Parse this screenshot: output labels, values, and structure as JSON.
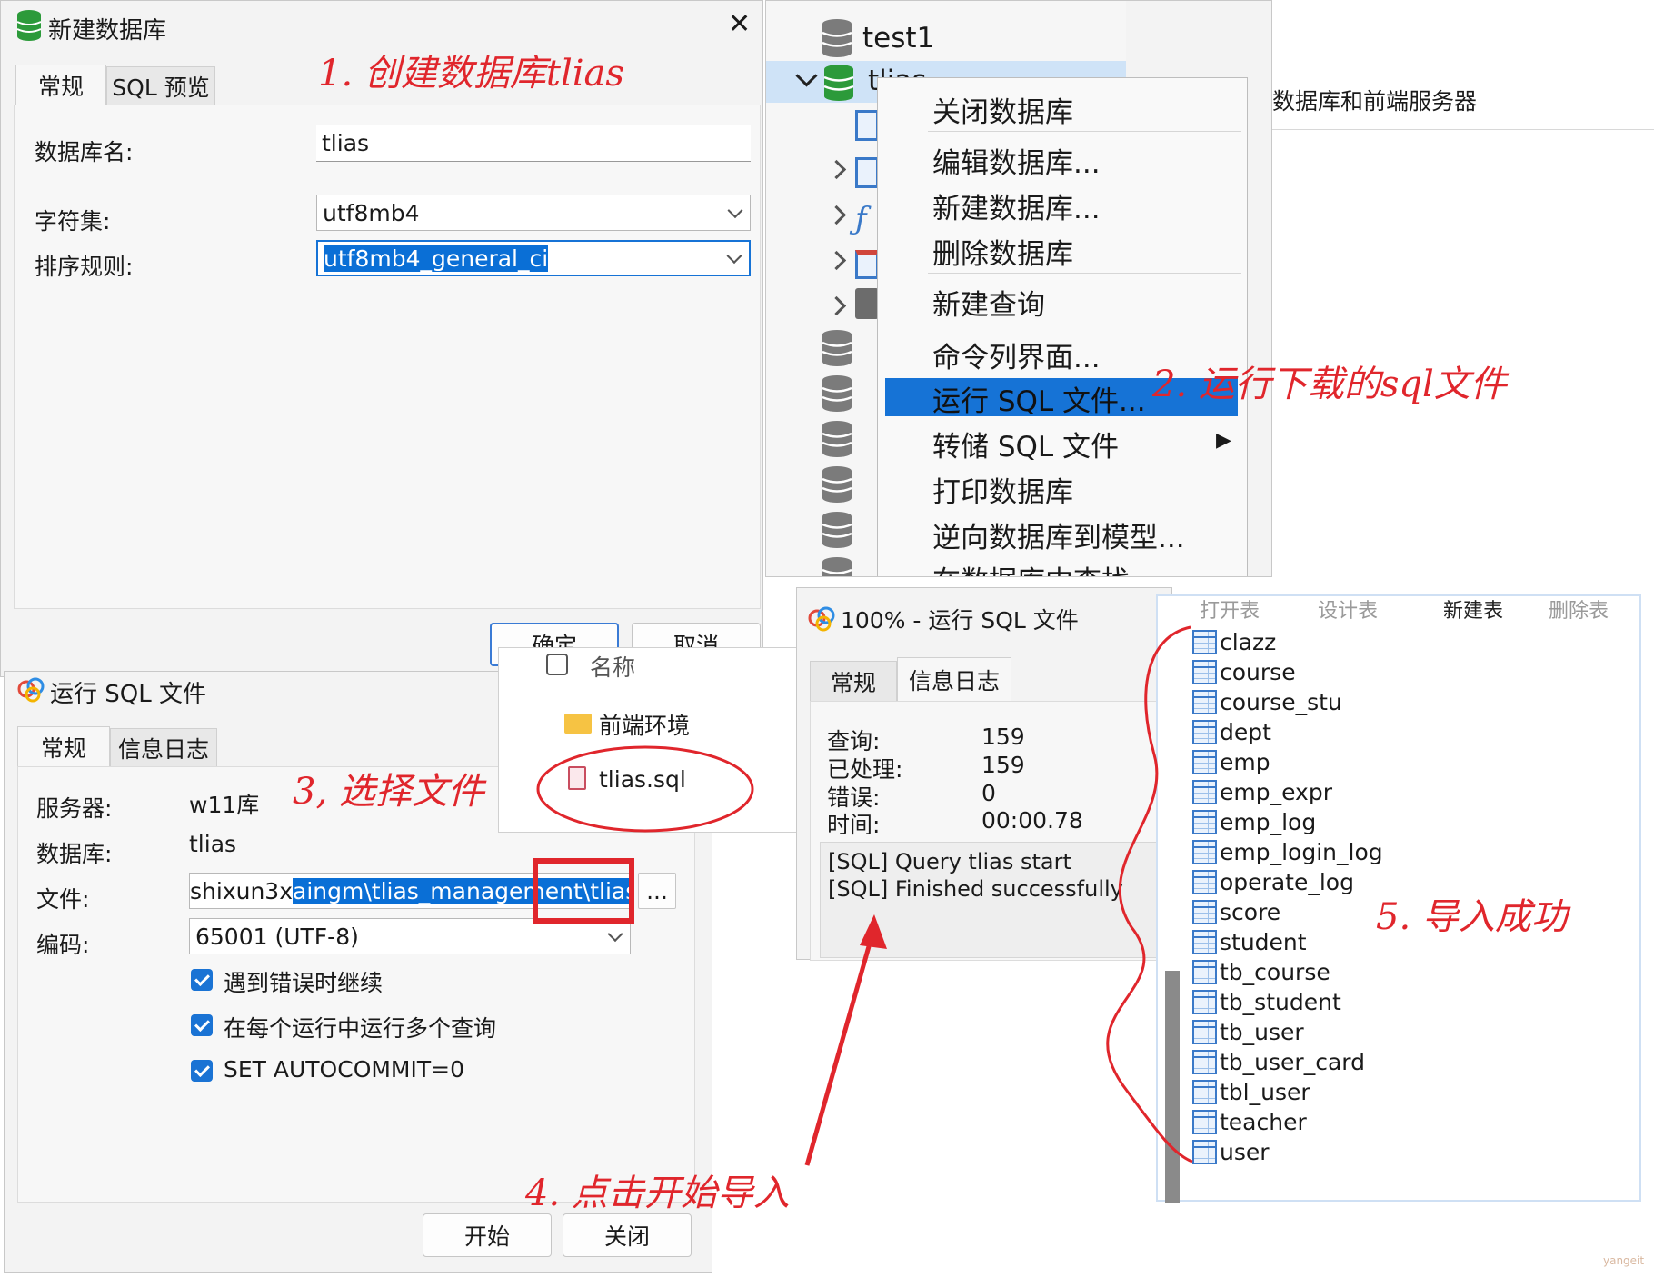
{
  "new_db_dialog": {
    "title": "新建数据库",
    "tabs": [
      "常规",
      "SQL 预览"
    ],
    "db_name_label": "数据库名:",
    "db_name_value": "tlias",
    "charset_label": "字符集:",
    "charset_value": "utf8mb4",
    "collation_label": "排序规则:",
    "collation_value": "utf8mb4_general_ci",
    "ok_label": "确定",
    "cancel_label": "取消",
    "close_glyph": "✕"
  },
  "nav_tree": {
    "top_item": "test1",
    "selected_item": "tlias",
    "right_text": "数据库和前端服务器"
  },
  "context_menu": {
    "items": [
      "关闭数据库",
      "编辑数据库...",
      "新建数据库...",
      "删除数据库",
      "新建查询",
      "命令列界面...",
      "运行 SQL 文件...",
      "转储 SQL 文件",
      "打印数据库",
      "逆向数据库到模型...",
      "在数据库中查找"
    ],
    "highlighted": "运行 SQL 文件...",
    "submenu_glyph": "▶"
  },
  "run_sql_dialog": {
    "title": "运行 SQL 文件",
    "tabs": [
      "常规",
      "信息日志"
    ],
    "server_label": "服务器:",
    "server_value": "w11库",
    "database_label": "数据库:",
    "database_value": "tlias",
    "file_label": "文件:",
    "file_value_plain": "shixun3x",
    "file_value_selected": "aingm\\tlias_management\\tlias.sql",
    "browse_label": "...",
    "encoding_label": "编码:",
    "encoding_value": "65001 (UTF-8)",
    "checkboxes": [
      "遇到错误时继续",
      "在每个运行中运行多个查询",
      "SET AUTOCOMMIT=0"
    ],
    "start_label": "开始",
    "close_label": "关闭"
  },
  "file_picker": {
    "header": "名称",
    "items": [
      "前端环境",
      "tlias.sql"
    ]
  },
  "progress_dialog": {
    "title": "100% - 运行 SQL 文件",
    "tabs": [
      "常规",
      "信息日志"
    ],
    "stats": [
      {
        "label": "查询:",
        "value": "159"
      },
      {
        "label": "已处理:",
        "value": "159"
      },
      {
        "label": "错误:",
        "value": "0"
      },
      {
        "label": "时间:",
        "value": "00:00.78"
      }
    ],
    "log": [
      "[SQL] Query tlias start",
      "[SQL] Finished successfully"
    ]
  },
  "tables_panel": {
    "toolbar": [
      "打开表",
      "设计表",
      "新建表",
      "删除表"
    ],
    "tables": [
      "clazz",
      "course",
      "course_stu",
      "dept",
      "emp",
      "emp_expr",
      "emp_log",
      "emp_login_log",
      "operate_log",
      "score",
      "student",
      "tb_course",
      "tb_student",
      "tb_user",
      "tb_user_card",
      "tbl_user",
      "teacher",
      "user"
    ]
  },
  "annotations": {
    "step1": "1. 创建数据库tlias",
    "step2": "2. 运行下载的sql文件",
    "step3": "3, 选择文件",
    "step4": "4. 点击开始导入",
    "step5": "5. 导入成功"
  },
  "watermark": "yangeit",
  "colors": {
    "annotation": "#e0262c",
    "highlight": "#0a6fd6",
    "db_icon": "#2c9a3a",
    "menu_highlight": "#1673d6"
  }
}
